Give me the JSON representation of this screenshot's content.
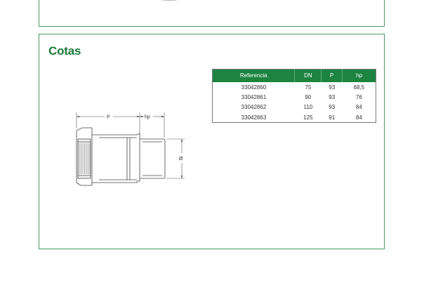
{
  "section": {
    "title": "Cotas"
  },
  "table": {
    "headers": [
      "Referencia",
      "DN",
      "P",
      "hp"
    ],
    "rows": [
      [
        "33042860",
        "75",
        "93",
        "68,5"
      ],
      [
        "33042861",
        "90",
        "93",
        "76"
      ],
      [
        "33042862",
        "110",
        "93",
        "84"
      ],
      [
        "33042863",
        "125",
        "91",
        "84"
      ]
    ]
  },
  "drawing": {
    "dim_p": "P",
    "dim_hp": "hp",
    "dim_diameter": "Ø"
  },
  "colors": {
    "accent": "#1c7a3a",
    "header_bg": "#1c8440",
    "panel_border": "#4a9a63"
  }
}
